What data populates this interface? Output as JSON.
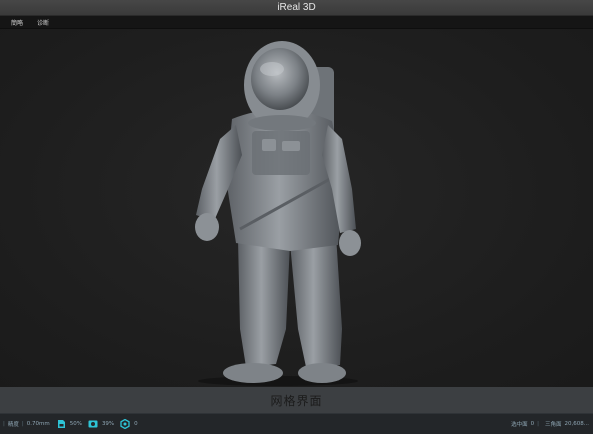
{
  "window": {
    "title": "iReal 3D"
  },
  "menu": {
    "items": [
      "簡略",
      "诊断"
    ]
  },
  "viewport": {
    "model_color": "#8a8f94",
    "background": "#1f1f1f"
  },
  "caption": {
    "text": "网格界面"
  },
  "status": {
    "precision_label": "精度",
    "precision_value": "0.70mm",
    "memory_percent": "50%",
    "capture_percent": "39%",
    "marker_count": "0",
    "selected_label": "选中面",
    "selected_value": "0",
    "triangles_label": "三角面",
    "triangles_value": "20,608..."
  }
}
